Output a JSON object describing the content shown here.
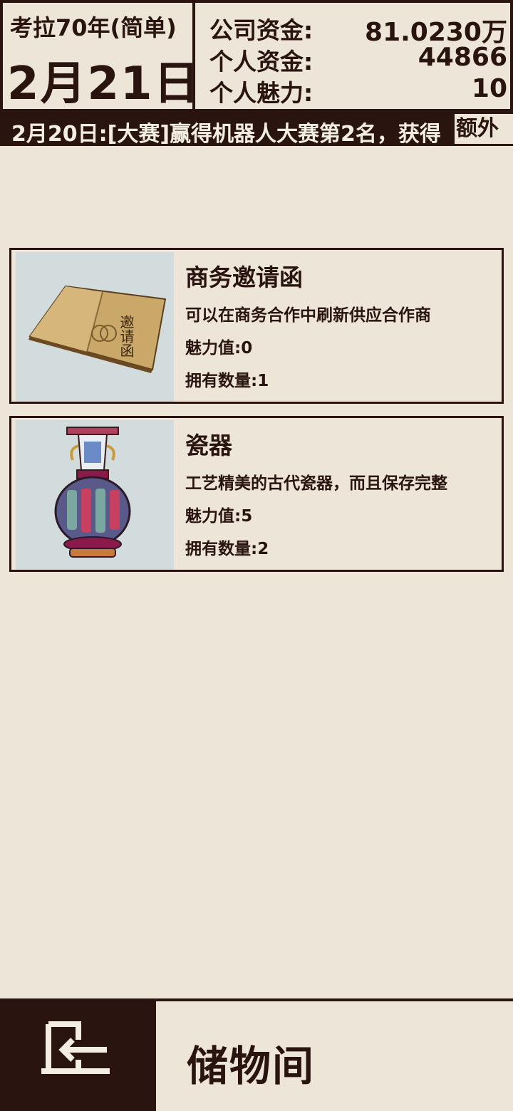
{
  "header": {
    "game_title": "考拉70年(简单)",
    "date": "2月21日",
    "stats": [
      {
        "label": "公司资金:",
        "value": "81.0230万"
      },
      {
        "label": "个人资金:",
        "value": "44866"
      },
      {
        "label": "个人魅力:",
        "value": "10"
      }
    ]
  },
  "ticker": {
    "text": "2月20日:[大赛]赢得机器人大赛第2名，获得",
    "highlight": "额外"
  },
  "items": [
    {
      "name": "商务邀请函",
      "description": "可以在商务合作中刷新供应合作商",
      "charm": "魅力值:0",
      "quantity": "拥有数量:1",
      "image_text": "邀请函"
    },
    {
      "name": "瓷器",
      "description": "工艺精美的古代瓷器，而且保存完整",
      "charm": "魅力值:5",
      "quantity": "拥有数量:2"
    }
  ],
  "footer": {
    "room_title": "储物间",
    "exit_icon": "exit-door-icon"
  },
  "colors": {
    "background": "#ede6d8",
    "dark": "#2a1410",
    "image_bg": "#d3dcdc"
  }
}
